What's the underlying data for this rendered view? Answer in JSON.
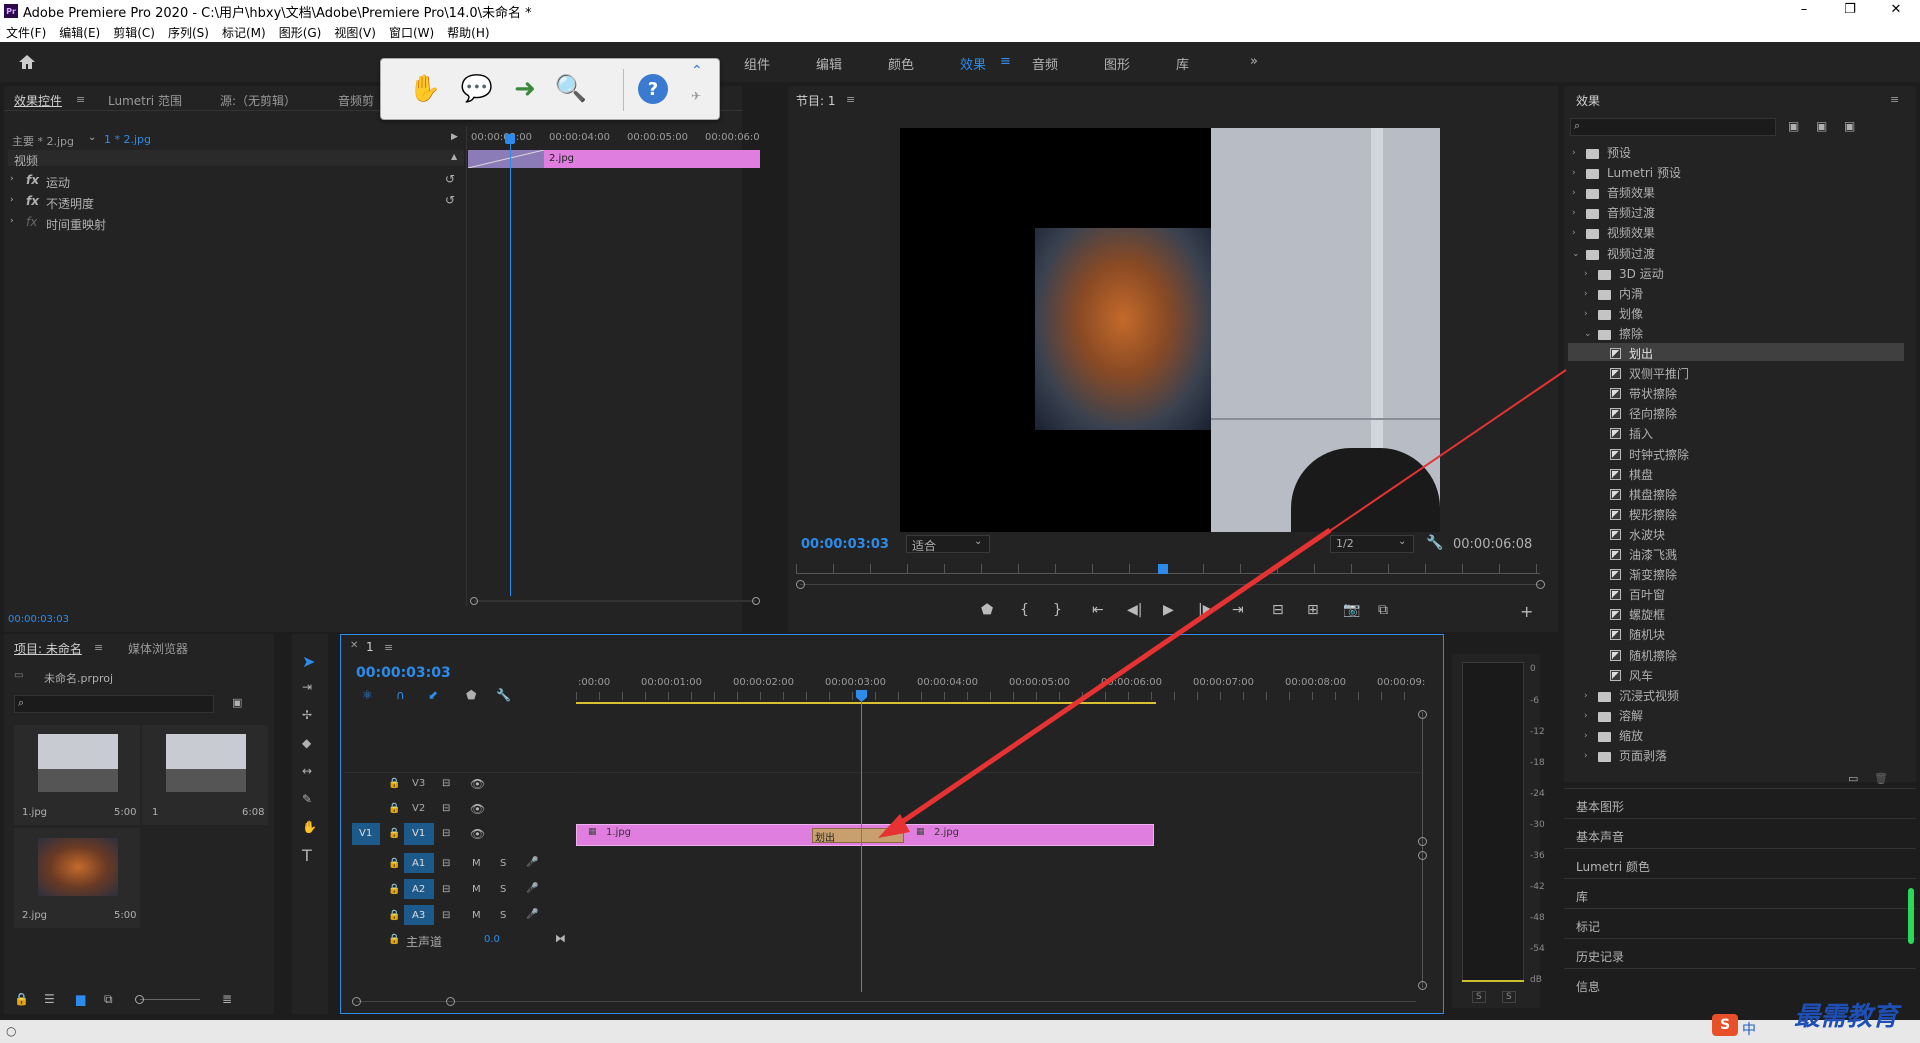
{
  "app": {
    "title": "Adobe Premiere Pro 2020 - C:\\用户\\hbxy\\文档\\Adobe\\Premiere Pro\\14.0\\未命名 *",
    "win_min": "–",
    "win_max": "❐",
    "win_close": "✕"
  },
  "menu": [
    "文件(F)",
    "编辑(E)",
    "剪辑(C)",
    "序列(S)",
    "标记(M)",
    "图形(G)",
    "视图(V)",
    "窗口(W)",
    "帮助(H)"
  ],
  "workspaces": {
    "items": [
      "组件",
      "编辑",
      "颜色",
      "效果",
      "音频",
      "图形",
      "库"
    ],
    "active": "效果",
    "more": "»"
  },
  "effect_controls": {
    "tabs": [
      "效果控件",
      "Lumetri 范围",
      "源:（无剪辑）",
      "音频剪"
    ],
    "master": "主要 * 2.jpg",
    "clip": "1 * 2.jpg",
    "section": "视频",
    "props": [
      "运动",
      "不透明度",
      "时间重映射"
    ],
    "ruler": [
      "00:00:03:00",
      "00:00:04:00",
      "00:00:05:00",
      "00:00:06:0"
    ],
    "clip_bar": "2.jpg",
    "timecode": "00:00:03:03"
  },
  "program": {
    "title": "节目: 1",
    "timecode": "00:00:03:03",
    "fit": "适合",
    "quality": "1/2",
    "duration": "00:00:06:08"
  },
  "project": {
    "tabs": [
      "项目: 未命名",
      "媒体浏览器"
    ],
    "file": "未命名.prproj",
    "items": [
      {
        "name": "1.jpg",
        "dur": "5:00"
      },
      {
        "name": "1",
        "dur": "6:08"
      },
      {
        "name": "2.jpg",
        "dur": "5:00"
      }
    ]
  },
  "timeline": {
    "tab": "1",
    "timecode": "00:00:03:03",
    "ruler": [
      ":00:00",
      "00:00:01:00",
      "00:00:02:00",
      "00:00:03:00",
      "00:00:04:00",
      "00:00:05:00",
      "00:00:06:00",
      "00:00:07:00",
      "00:00:08:00",
      "00:00:09:"
    ],
    "tracks": [
      {
        "id": "V3",
        "src": ""
      },
      {
        "id": "V2",
        "src": ""
      },
      {
        "id": "V1",
        "src": "V1"
      },
      {
        "id": "A1",
        "src": ""
      },
      {
        "id": "A2",
        "src": ""
      },
      {
        "id": "A3",
        "src": ""
      }
    ],
    "master_label": "主声道",
    "master_value": "0.0",
    "clips": [
      {
        "name": "1.jpg"
      },
      {
        "name": "2.jpg"
      }
    ],
    "transition": "划出",
    "mute": "M",
    "solo": "S"
  },
  "effects": {
    "title": "效果",
    "tree": [
      {
        "label": "预设",
        "level": 0,
        "type": "folder",
        "open": false
      },
      {
        "label": "Lumetri 预设",
        "level": 0,
        "type": "folder",
        "open": false
      },
      {
        "label": "音频效果",
        "level": 0,
        "type": "folder",
        "open": false
      },
      {
        "label": "音频过渡",
        "level": 0,
        "type": "folder",
        "open": false
      },
      {
        "label": "视频效果",
        "level": 0,
        "type": "folder",
        "open": false
      },
      {
        "label": "视频过渡",
        "level": 0,
        "type": "folder",
        "open": true
      },
      {
        "label": "3D 运动",
        "level": 1,
        "type": "folder",
        "open": false
      },
      {
        "label": "内滑",
        "level": 1,
        "type": "folder",
        "open": false
      },
      {
        "label": "划像",
        "level": 1,
        "type": "folder",
        "open": false
      },
      {
        "label": "擦除",
        "level": 1,
        "type": "folder",
        "open": true
      },
      {
        "label": "划出",
        "level": 2,
        "type": "fx",
        "selected": true
      },
      {
        "label": "双侧平推门",
        "level": 2,
        "type": "fx"
      },
      {
        "label": "带状擦除",
        "level": 2,
        "type": "fx"
      },
      {
        "label": "径向擦除",
        "level": 2,
        "type": "fx"
      },
      {
        "label": "插入",
        "level": 2,
        "type": "fx"
      },
      {
        "label": "时钟式擦除",
        "level": 2,
        "type": "fx"
      },
      {
        "label": "棋盘",
        "level": 2,
        "type": "fx"
      },
      {
        "label": "棋盘擦除",
        "level": 2,
        "type": "fx"
      },
      {
        "label": "楔形擦除",
        "level": 2,
        "type": "fx"
      },
      {
        "label": "水波块",
        "level": 2,
        "type": "fx"
      },
      {
        "label": "油漆飞溅",
        "level": 2,
        "type": "fx"
      },
      {
        "label": "渐变擦除",
        "level": 2,
        "type": "fx"
      },
      {
        "label": "百叶窗",
        "level": 2,
        "type": "fx"
      },
      {
        "label": "螺旋框",
        "level": 2,
        "type": "fx"
      },
      {
        "label": "随机块",
        "level": 2,
        "type": "fx"
      },
      {
        "label": "随机擦除",
        "level": 2,
        "type": "fx"
      },
      {
        "label": "风车",
        "level": 2,
        "type": "fx"
      },
      {
        "label": "沉浸式视频",
        "level": 1,
        "type": "folder",
        "open": false
      },
      {
        "label": "溶解",
        "level": 1,
        "type": "folder",
        "open": false
      },
      {
        "label": "缩放",
        "level": 1,
        "type": "folder",
        "open": false
      },
      {
        "label": "页面剥落",
        "level": 1,
        "type": "folder",
        "open": false
      }
    ],
    "side_panels": [
      "基本图形",
      "基本声音",
      "Lumetri 颜色",
      "库",
      "标记",
      "历史记录",
      "信息"
    ]
  },
  "meter": {
    "scale": [
      "0",
      "-6",
      "-12",
      "-18",
      "-24",
      "-30",
      "-36",
      "-42",
      "-48",
      "-54",
      "dB"
    ],
    "solo": [
      "S",
      "S"
    ]
  },
  "watermark": "最需教育",
  "ime": "中",
  "colors": {
    "accent": "#2d8ceb",
    "clip": "#e07ee0",
    "transition": "#c8a070",
    "arrow": "#e63232"
  }
}
